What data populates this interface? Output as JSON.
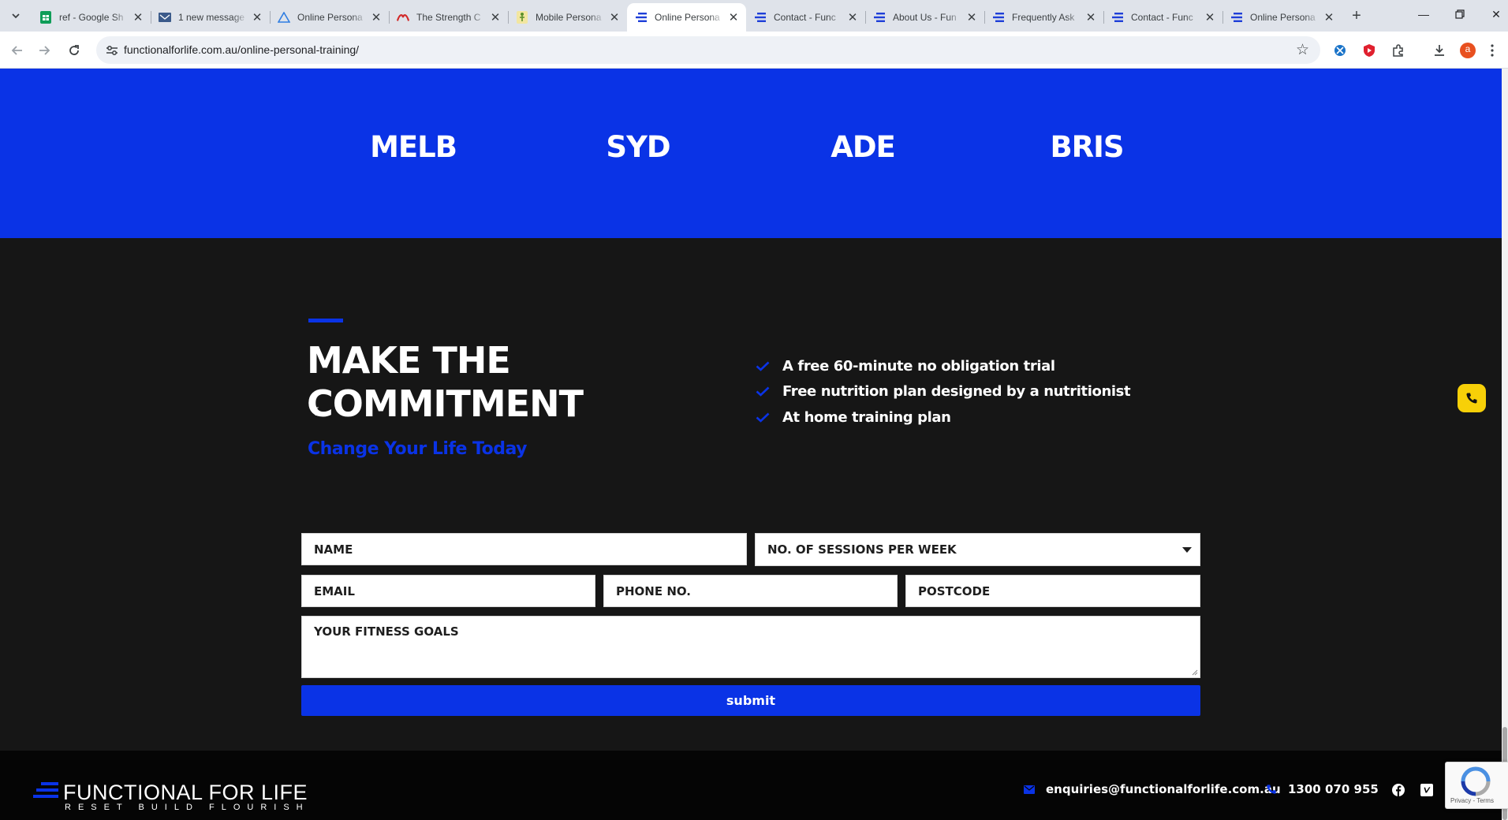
{
  "browser": {
    "tabs": [
      {
        "title": "ref - Google Sh",
        "icon": "google-sheets-icon",
        "active": false
      },
      {
        "title": "1 new message",
        "icon": "mail-icon",
        "active": false
      },
      {
        "title": "Online Persona",
        "icon": "triangle-logo-icon",
        "active": false
      },
      {
        "title": "The Strength C",
        "icon": "strength-logo-icon",
        "active": false
      },
      {
        "title": "Mobile Persona",
        "icon": "figure-logo-icon",
        "active": false
      },
      {
        "title": "Online Persona",
        "icon": "ffl-logo-icon",
        "active": true
      },
      {
        "title": "Contact - Func",
        "icon": "ffl-logo-icon",
        "active": false
      },
      {
        "title": "About Us - Fun",
        "icon": "ffl-logo-icon",
        "active": false
      },
      {
        "title": "Frequently Ask",
        "icon": "ffl-logo-icon",
        "active": false
      },
      {
        "title": "Contact - Func",
        "icon": "ffl-logo-icon",
        "active": false
      },
      {
        "title": "Online Persona",
        "icon": "ffl-logo-icon",
        "active": false
      }
    ],
    "url": "functionalforlife.com.au/online-personal-training/",
    "profile_initial": "a"
  },
  "cities": [
    "MELB",
    "SYD",
    "ADE",
    "BRIS"
  ],
  "commitment": {
    "heading_line1": "MAKE THE",
    "heading_line2": "COMMITMENT",
    "subheading": "Change Your Life Today",
    "benefits": [
      "A free 60-minute no obligation trial",
      "Free nutrition plan designed by a nutritionist",
      "At home training plan"
    ]
  },
  "form": {
    "name_placeholder": "NAME",
    "sessions_placeholder": "NO. OF SESSIONS PER WEEK",
    "email_placeholder": "EMAIL",
    "phone_placeholder": "PHONE NO.",
    "postcode_placeholder": "POSTCODE",
    "goals_placeholder": "YOUR FITNESS GOALS",
    "submit_label": "submit"
  },
  "footer": {
    "brand": "FUNCTIONAL FOR LIFE",
    "tagline": "RESET BUILD FLOURISH",
    "email": "enquiries@functionalforlife.com.au",
    "phone": "1300 070 955"
  },
  "recaptcha": {
    "terms": "Privacy - Terms"
  },
  "colors": {
    "brand_blue": "#0a33e6",
    "dark_bg": "#161616",
    "phone_button": "#f7d008"
  }
}
